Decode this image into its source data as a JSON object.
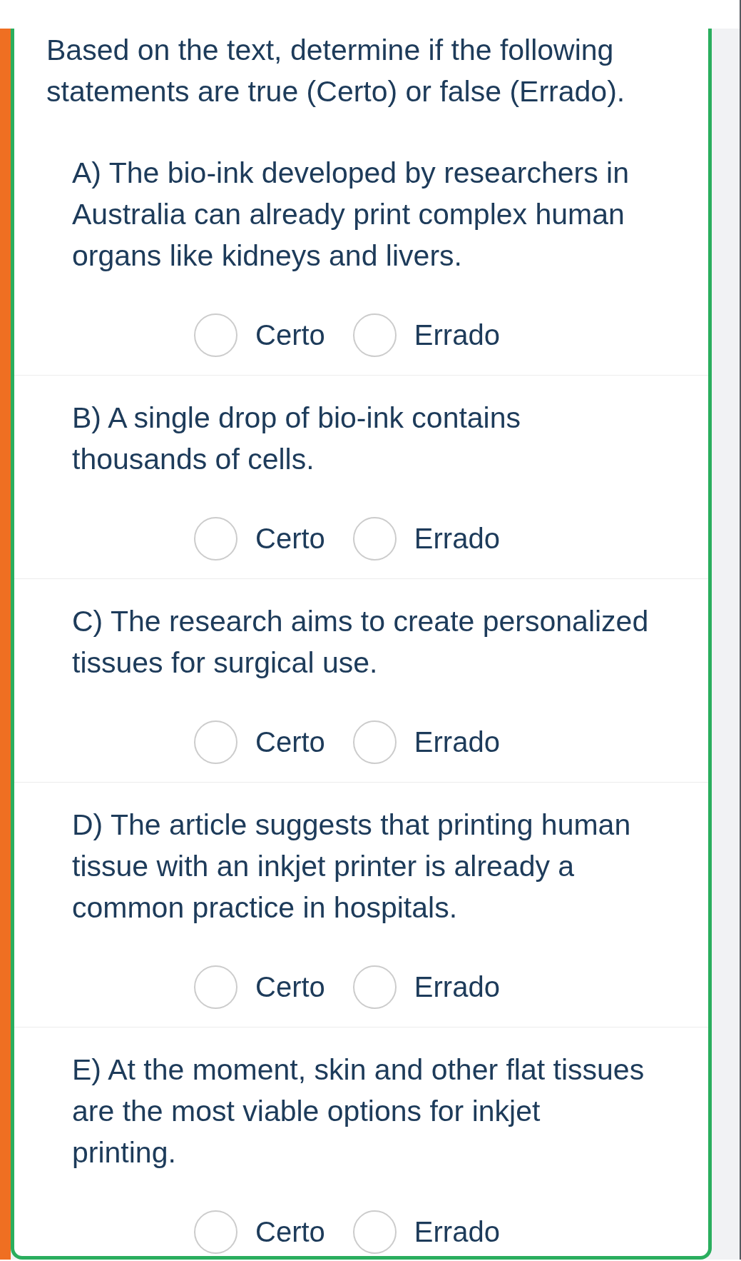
{
  "instruction": "Based on the text, determine if the following statements are true (Certo) or false (Errado).",
  "statements": [
    {
      "text": "A) The bio-ink developed by researchers in Australia can already print complex human organs like kidneys and livers.",
      "options": [
        {
          "label": "Certo",
          "selected": false
        },
        {
          "label": "Errado",
          "selected": false
        }
      ]
    },
    {
      "text": "B) A single drop of bio-ink contains thousands of cells.",
      "options": [
        {
          "label": "Certo",
          "selected": false
        },
        {
          "label": "Errado",
          "selected": false
        }
      ]
    },
    {
      "text": "C) The research aims to create personalized tissues for surgical use.",
      "options": [
        {
          "label": "Certo",
          "selected": false
        },
        {
          "label": "Errado",
          "selected": false
        }
      ]
    },
    {
      "text": "D) The article suggests that printing human tissue with an inkjet printer is already a common practice in hospitals.",
      "options": [
        {
          "label": "Certo",
          "selected": false
        },
        {
          "label": "Errado",
          "selected": false
        }
      ]
    },
    {
      "text": "E) At the moment, skin and other flat tissues are the most viable options for inkjet printing.",
      "options": [
        {
          "label": "Certo",
          "selected": false
        },
        {
          "label": "Errado",
          "selected": false
        }
      ]
    }
  ]
}
